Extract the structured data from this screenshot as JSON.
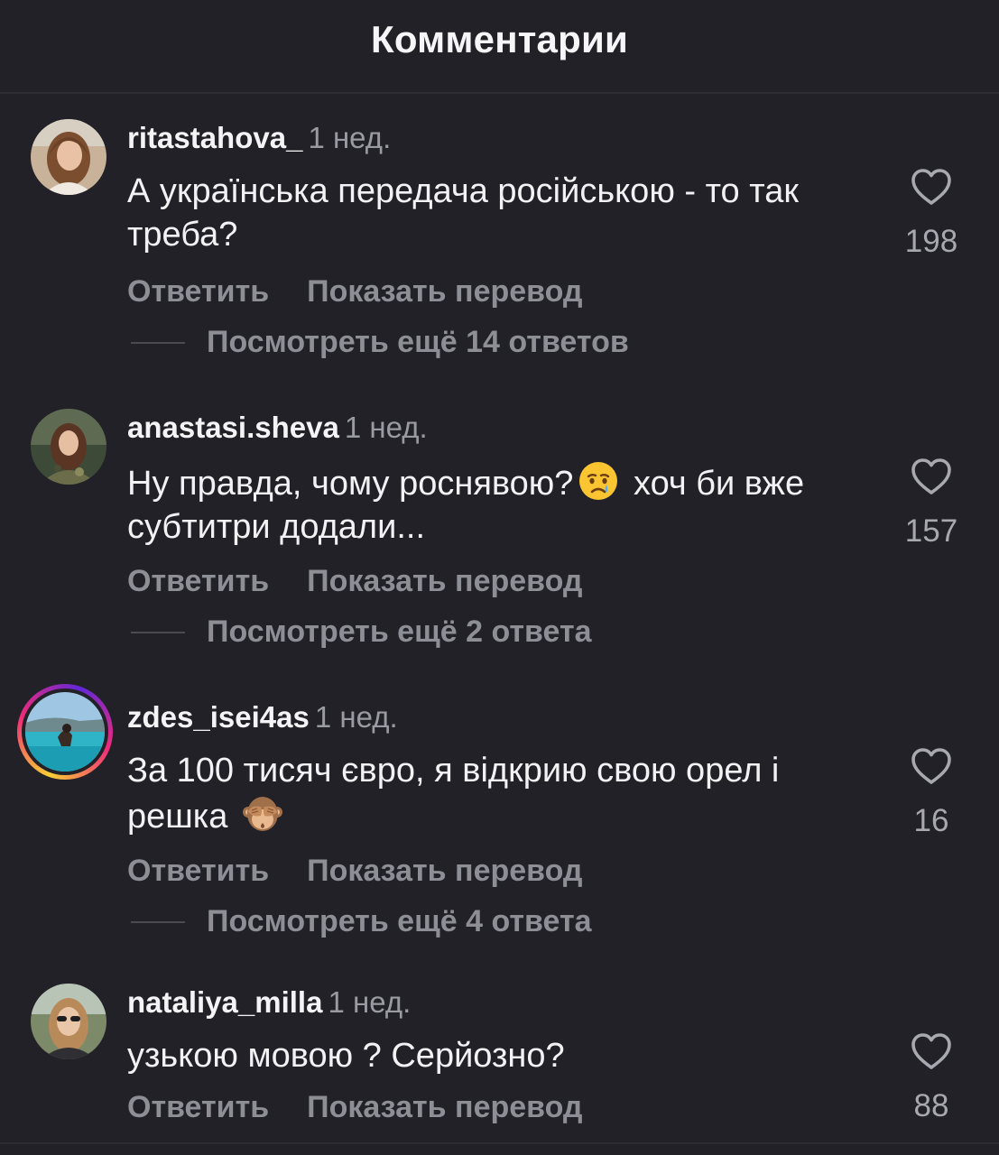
{
  "header": {
    "title": "Комментарии"
  },
  "comments": [
    {
      "username": "ritastahova_",
      "time": "1 нед.",
      "text": "А українська передача російською - то так треба?",
      "reply_label": "Ответить",
      "translate_label": "Показать перевод",
      "view_replies": "Посмотреть ещё 14 ответов",
      "likes": "198"
    },
    {
      "username": "anastasi.sheva",
      "time": "1 нед.",
      "text_before": "Ну правда, чому роснявою?",
      "emoji": "crying-face",
      "text_after": " хоч би вже субтитри додали...",
      "reply_label": "Ответить",
      "translate_label": "Показать перевод",
      "view_replies": "Посмотреть ещё 2 ответа",
      "likes": "157"
    },
    {
      "username": "zdes_isei4as",
      "time": "1 нед.",
      "text_before": "За 100 тисяч євро, я відкрию свою орел і решка ",
      "emoji": "see-no-evil-monkey",
      "reply_label": "Ответить",
      "translate_label": "Показать перевод",
      "view_replies": "Посмотреть ещё 4 ответа",
      "likes": "16"
    },
    {
      "username": "nataliya_milla",
      "time": "1 нед.",
      "text": "узькою мовою ? Серйозно?",
      "reply_label": "Ответить",
      "translate_label": "Показать перевод",
      "likes": "88"
    }
  ],
  "colors": {
    "background": "#212127",
    "text_primary": "#f2f2f4",
    "text_secondary": "#8e8e96",
    "story_ring": [
      "#f9ce34",
      "#ee2a7b",
      "#6228d7"
    ]
  },
  "icons": [
    "heart-outline-icon"
  ]
}
